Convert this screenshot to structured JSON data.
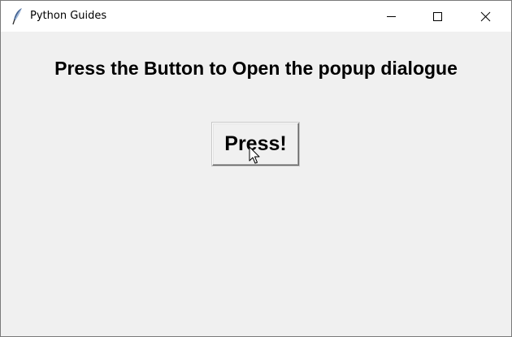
{
  "window": {
    "title": "Python Guides",
    "icon": "feather-icon",
    "controls": [
      "minimize-icon",
      "maximize-icon",
      "close-icon"
    ]
  },
  "main": {
    "heading": "Press the Button to Open the popup dialogue",
    "button_label": "Press!"
  },
  "pointer": {
    "icon": "mouse-pointer-icon"
  }
}
